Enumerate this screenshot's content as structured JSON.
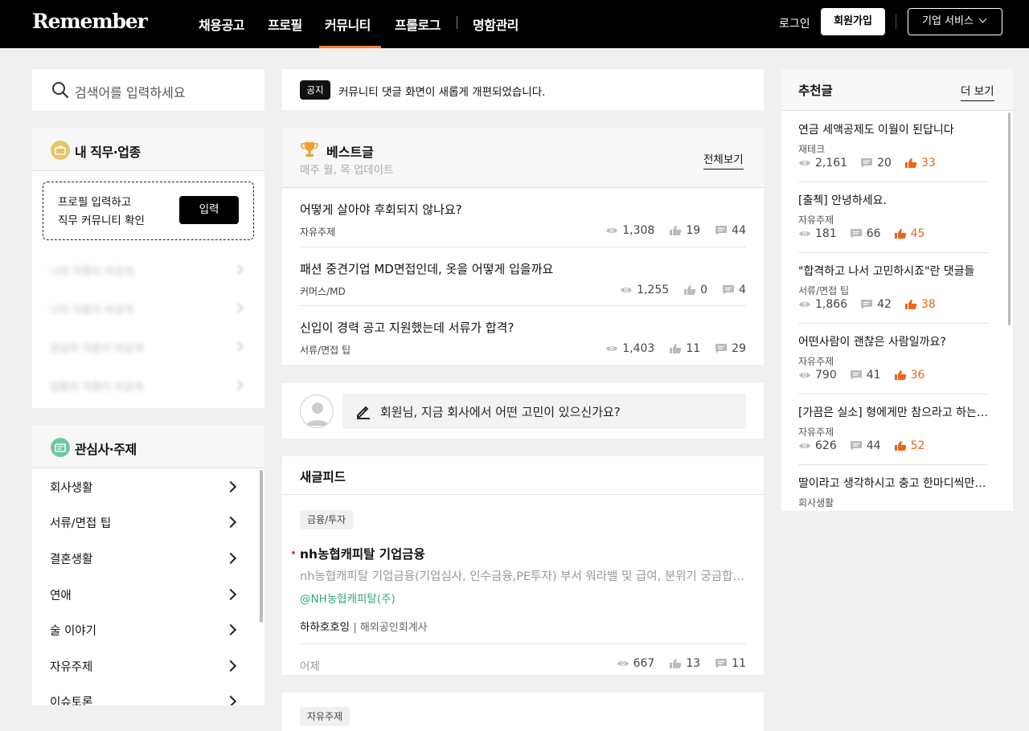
{
  "header": {
    "logo": "Remember",
    "nav": [
      "채용공고",
      "프로필",
      "커뮤니티",
      "프롤로그",
      "명함관리"
    ],
    "active_nav": "커뮤니티",
    "login": "로그인",
    "signup": "회원가입",
    "business": "기업 서비스"
  },
  "colors": {
    "accent": "#f0823c",
    "hot": "#e8661f",
    "company": "#2eaa72"
  },
  "search": {
    "placeholder": "검색어를 입력하세요"
  },
  "job_panel": {
    "title": "내 직무·업종",
    "prompt_line1": "프로필 입력하고",
    "prompt_line2": "직무 커뮤니티 확인",
    "button": "입력",
    "blurred_items": [
      "나의 직종이 비공개",
      "나의 직종이 비공개",
      "관심의 직종이 비공개",
      "업종의 직종이 비공개"
    ]
  },
  "interest_panel": {
    "title": "관심사·주제",
    "topics": [
      "회사생활",
      "서류/면접 팁",
      "결혼생활",
      "연애",
      "술 이야기",
      "자유주제",
      "이슈토론"
    ]
  },
  "notice": {
    "tag": "공지",
    "text": "커뮤니티 댓글 화면이 새롭게 개편되었습니다."
  },
  "best": {
    "title": "베스트글",
    "subtitle": "매주 월, 목 업데이트",
    "view_all": "전체보기",
    "posts": [
      {
        "title": "어떻게 살아야 후회되지 않나요?",
        "category": "자유주제",
        "views": "1,308",
        "likes": "19",
        "comments": "44"
      },
      {
        "title": "패션 중견기업 MD면접인데, 옷을 어떻게 입을까요",
        "category": "커머스/MD",
        "views": "1,255",
        "likes": "0",
        "comments": "4"
      },
      {
        "title": "신입이 경력 공고 지원했는데 서류가 합격?",
        "category": "서류/면접 팁",
        "views": "1,403",
        "likes": "11",
        "comments": "29"
      }
    ]
  },
  "write": {
    "placeholder": "회원님, 지금 회사에서 어떤 고민이 있으신가요?"
  },
  "feed": {
    "title": "새글피드",
    "post": {
      "category": "금융/투자",
      "title": "nh농협캐피탈 기업금융",
      "preview": "nh농협캐피탈 기업금융(기업심사, 인수금융,PE투자) 부서 워라밸 및 급여, 분위기 궁금합니다",
      "company": "@NH농협캐피탈(주)",
      "author": "하하호호잉",
      "author_job": "해외공인회계사",
      "time": "어제",
      "views": "667",
      "likes": "13",
      "comments": "11"
    },
    "next_category": "자유주제"
  },
  "recommend": {
    "title": "추천글",
    "more": "더 보기",
    "items": [
      {
        "title": "연금 세액공제도 이월이 된답니다",
        "category": "재테크",
        "views": "2,161",
        "comments": "20",
        "likes": "33"
      },
      {
        "title": "[출첵] 안녕하세요.",
        "category": "자유주제",
        "views": "181",
        "comments": "66",
        "likes": "45"
      },
      {
        "title": "\"합격하고 나서 고민하시죠\"란 댓글들",
        "category": "서류/면접 팁",
        "views": "1,866",
        "comments": "42",
        "likes": "38"
      },
      {
        "title": "어떤사람이 괜찮은 사람일까요?",
        "category": "자유주제",
        "views": "790",
        "comments": "41",
        "likes": "36"
      },
      {
        "title": "[가끔은 실소] 형에게만 참으라고 하는 부모님",
        "category": "자유주제",
        "views": "626",
        "comments": "44",
        "likes": "52"
      },
      {
        "title": "딸이라고 생각하시고 충고 한마디씩만 부탁드려요",
        "category": "회사생활",
        "views": "",
        "comments": "",
        "likes": ""
      }
    ]
  }
}
